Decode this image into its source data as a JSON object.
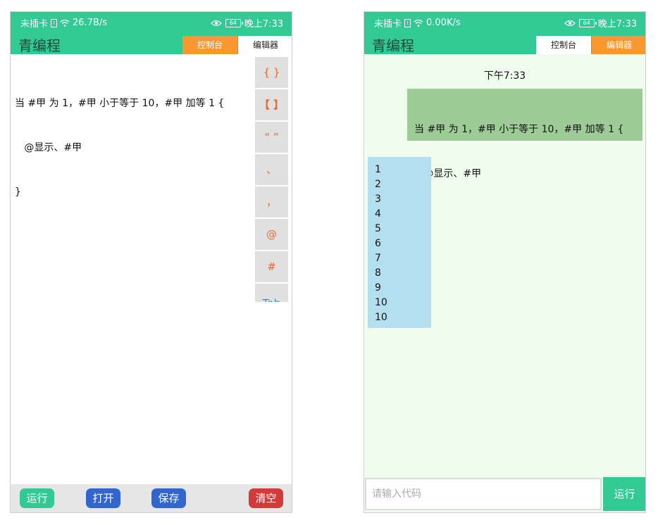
{
  "app_title": "青编程",
  "colors": {
    "green": "#33c994",
    "orange": "#f9982f",
    "blue": "#3366cc",
    "red": "#d33a3a",
    "console_bg": "#f0fdee",
    "sent_bubble": "#9dcc97",
    "output_bubble": "#b3dfee"
  },
  "icons": [
    "sim-icon",
    "wifi-icon",
    "eye-icon",
    "battery-icon"
  ],
  "editor_screen": {
    "status": {
      "carrier": "未插卡",
      "speed": "26.7B/s",
      "battery": "64",
      "time": "晚上7:33"
    },
    "tabs": {
      "console": "控制台",
      "editor": "编辑器"
    },
    "code_lines": [
      "当 #甲 为 1，#甲 小于等于 10，#甲 加等 1 {",
      "   @显示、#甲",
      "}"
    ],
    "quick_keys": [
      "{ }",
      "【 】",
      "“ ”",
      "、",
      "，",
      "@",
      "#",
      "Tab"
    ],
    "buttons": {
      "run": "运行",
      "open": "打开",
      "save": "保存",
      "clear": "清空"
    }
  },
  "console_screen": {
    "status": {
      "carrier": "未插卡",
      "speed": "0.00K/s",
      "battery": "64",
      "time": "晚上7:33"
    },
    "tabs": {
      "console": "控制台",
      "editor": "编辑器"
    },
    "timestamp": "下午7:33",
    "sent_code_lines": [
      "当 #甲 为 1，#甲 小于等于 10，#甲 加等 1 {",
      "   @显示、#甲",
      "}"
    ],
    "output_lines": [
      "1",
      "2",
      "3",
      "4",
      "5",
      "6",
      "7",
      "8",
      "9",
      "10",
      "10"
    ],
    "input_placeholder": "请输入代码",
    "run_label": "运行"
  }
}
